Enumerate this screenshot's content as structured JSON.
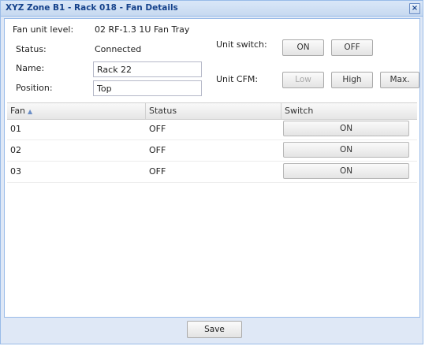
{
  "window": {
    "title": "XYZ Zone B1 - Rack 018 - Fan Details",
    "close_label": "×"
  },
  "info": {
    "fan_unit_level_label": "Fan unit level:",
    "fan_unit_level_value": "02 RF-1.3 1U Fan Tray",
    "status_label": "Status:",
    "status_value": "Connected",
    "name_label": "Name:",
    "name_value": "Rack 22",
    "position_label": "Position:",
    "position_value": "Top"
  },
  "unit_switch": {
    "label": "Unit switch:",
    "on_label": "ON",
    "off_label": "OFF"
  },
  "unit_cfm": {
    "label": "Unit CFM:",
    "low_label": "Low",
    "high_label": "High",
    "max_label": "Max."
  },
  "grid": {
    "columns": [
      "Fan",
      "Status",
      "Switch"
    ],
    "sort_indicator": "▲",
    "rows": [
      {
        "fan": "01",
        "status": "OFF",
        "switch_label": "ON"
      },
      {
        "fan": "02",
        "status": "OFF",
        "switch_label": "ON"
      },
      {
        "fan": "03",
        "status": "OFF",
        "switch_label": "ON"
      }
    ]
  },
  "footer": {
    "save_label": "Save"
  }
}
